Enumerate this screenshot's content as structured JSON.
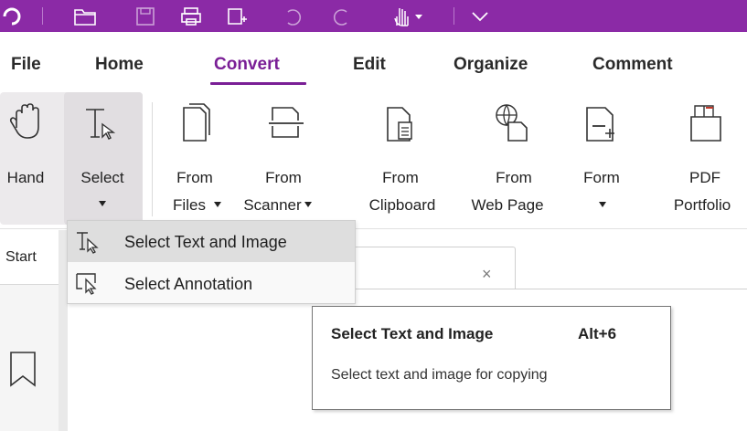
{
  "quick_access": {
    "icons": [
      "app-logo-icon",
      "open-folder-icon",
      "save-icon",
      "print-icon",
      "new-tab-icon",
      "undo-icon",
      "redo-icon",
      "hand-tool-icon",
      "customize-dropdown-icon"
    ]
  },
  "menu": {
    "tabs": [
      {
        "label": "File"
      },
      {
        "label": "Home"
      },
      {
        "label": "Convert"
      },
      {
        "label": "Edit"
      },
      {
        "label": "Organize"
      },
      {
        "label": "Comment"
      }
    ],
    "active_tab": "Convert"
  },
  "ribbon": {
    "hand": {
      "label": "Hand"
    },
    "select": {
      "label": "Select"
    },
    "from_files": {
      "line1": "From",
      "line2": "Files"
    },
    "from_scanner": {
      "line1": "From",
      "line2": "Scanner"
    },
    "from_clipboard": {
      "line1": "From",
      "line2": "Clipboard"
    },
    "from_web_page": {
      "line1": "From",
      "line2": "Web Page"
    },
    "form": {
      "label": "Form"
    },
    "pdf_portfolio": {
      "line1": "PDF",
      "line2": "Portfolio"
    }
  },
  "left_panel": {
    "start_label": "Start"
  },
  "doc_tab": {
    "close": "×"
  },
  "select_menu": {
    "items": [
      {
        "label": "Select Text and Image",
        "icon": "select-text-icon",
        "highlighted": true
      },
      {
        "label": "Select Annotation",
        "icon": "select-annotation-icon",
        "highlighted": false
      }
    ]
  },
  "tooltip": {
    "title": "Select Text and Image",
    "shortcut": "Alt+6",
    "description": "Select text and image for copying"
  },
  "colors": {
    "title_bar": "#8b2aa6",
    "accent": "#7a1f96"
  }
}
